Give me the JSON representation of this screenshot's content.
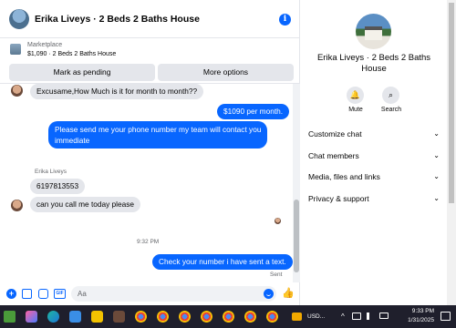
{
  "header": {
    "title": "Erika Liveys · 2 Beds 2 Baths House",
    "info_glyph": "i"
  },
  "marketplace": {
    "label": "Marketplace",
    "listing": "$1,090 · 2 Beds 2 Baths House",
    "pending_button": "Mark as pending",
    "options_button": "More options"
  },
  "messages": [
    {
      "from": "them",
      "text": "Excusame,How Much is it for month to month??"
    },
    {
      "from": "me",
      "text": "$1090 per month."
    },
    {
      "from": "me",
      "text": "Please send me your phone number my team will contact you"
    },
    {
      "from": "me",
      "text": "immediate"
    },
    {
      "from": "them",
      "sender": "Erika Liveys",
      "text": "6197813553"
    },
    {
      "from": "them",
      "text": "can you call me today please"
    },
    {
      "timestamp": "9:32 PM"
    },
    {
      "from": "me",
      "text": "Check your number i have sent a text.",
      "status": "Sent"
    }
  ],
  "composer": {
    "placeholder": "Aa",
    "plus_glyph": "+",
    "gif_glyph": "GIF",
    "like_glyph": "👍"
  },
  "info_panel": {
    "name_line1": "Erika Liveys · 2 Beds 2 Baths",
    "name_line2": "House",
    "mute_label": "Mute",
    "search_label": "Search",
    "mute_glyph": "🔔",
    "search_glyph": "⌕",
    "sections": [
      "Customize chat",
      "Chat members",
      "Media, files and links",
      "Privacy & support"
    ],
    "chevron": "⌄"
  },
  "taskbar": {
    "tray_label": "USD...",
    "time": "9:33 PM",
    "date": "1/31/2025",
    "chevron": "^"
  },
  "colors": {
    "accent": "#0866ff",
    "incoming_bubble": "#e4e6eb",
    "taskbar": "#1f1f2c"
  }
}
